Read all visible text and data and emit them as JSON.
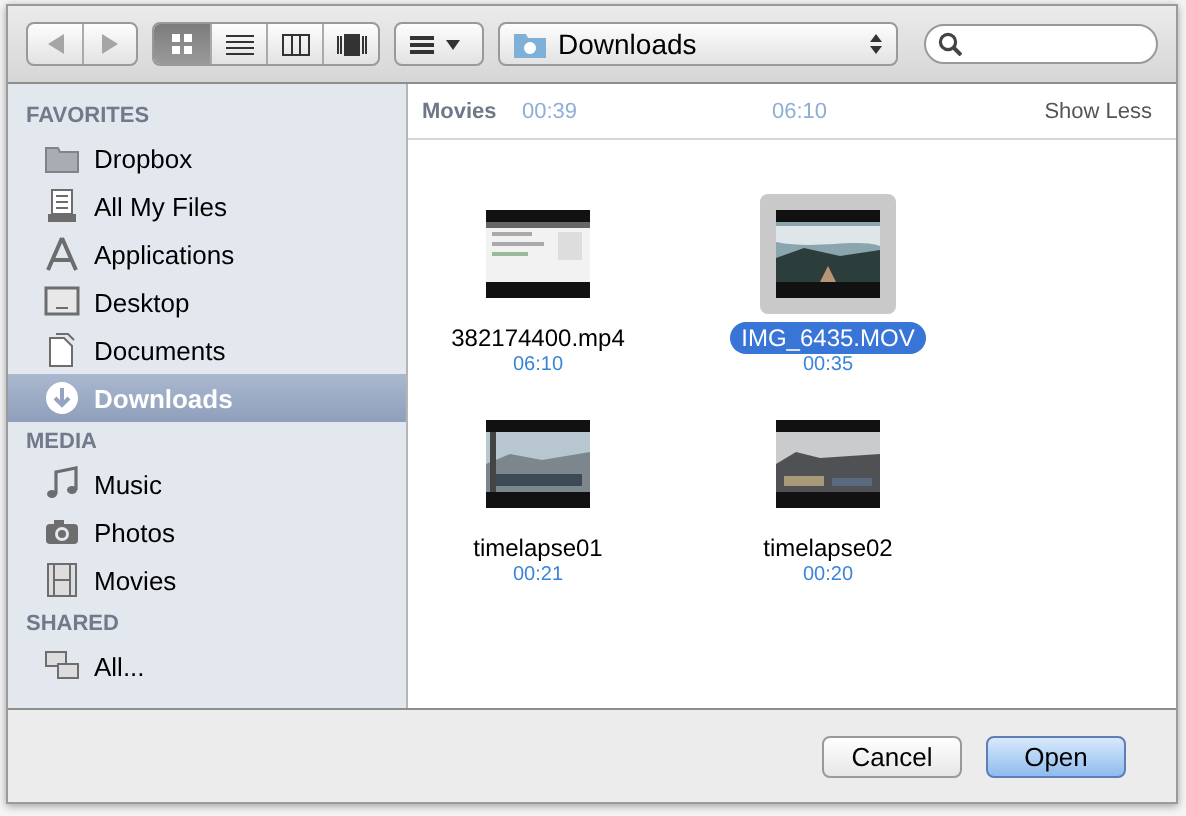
{
  "toolbar": {
    "nav": [
      {
        "kind": "back",
        "disabled": true
      },
      {
        "kind": "forward",
        "disabled": true
      }
    ],
    "views": [
      {
        "kind": "icon",
        "selected": true
      },
      {
        "kind": "list",
        "selected": false
      },
      {
        "kind": "columns",
        "selected": false
      },
      {
        "kind": "coverflow",
        "selected": false
      }
    ],
    "location": "Downloads"
  },
  "sidebar": [
    {
      "title": "FAVORITES",
      "items": [
        {
          "label": "Dropbox",
          "kind": "folder",
          "selected": false
        },
        {
          "label": "All My Files",
          "kind": "files",
          "selected": false
        },
        {
          "label": "Applications",
          "kind": "apps",
          "selected": false
        },
        {
          "label": "Desktop",
          "kind": "desktop",
          "selected": false
        },
        {
          "label": "Documents",
          "kind": "documents",
          "selected": false
        },
        {
          "label": "Downloads",
          "kind": "downloads",
          "selected": true
        }
      ]
    },
    {
      "title": "MEDIA",
      "items": [
        {
          "label": "Music",
          "kind": "music",
          "selected": false
        },
        {
          "label": "Photos",
          "kind": "camera",
          "selected": false
        },
        {
          "label": "Movies",
          "kind": "film",
          "selected": false
        }
      ]
    },
    {
      "title": "SHARED",
      "items": [
        {
          "label": "All...",
          "kind": "network",
          "selected": false
        }
      ]
    }
  ],
  "section": {
    "title": "Movies",
    "toggle": "Show Less",
    "scrolled_captions": [
      "00:39",
      "06:10"
    ]
  },
  "files": [
    {
      "name": "382174400.mp4",
      "duration": "06:10",
      "selected": false,
      "kind": "screen"
    },
    {
      "name": "IMG_6435.MOV",
      "duration": "00:35",
      "selected": true,
      "kind": "sky"
    },
    {
      "name": "timelapse01",
      "duration": "00:21",
      "selected": false,
      "kind": "city"
    },
    {
      "name": "timelapse02",
      "duration": "00:20",
      "selected": false,
      "kind": "hills"
    }
  ],
  "buttons": [
    {
      "label": "Cancel",
      "default": false
    },
    {
      "label": "Open",
      "default": true
    }
  ]
}
